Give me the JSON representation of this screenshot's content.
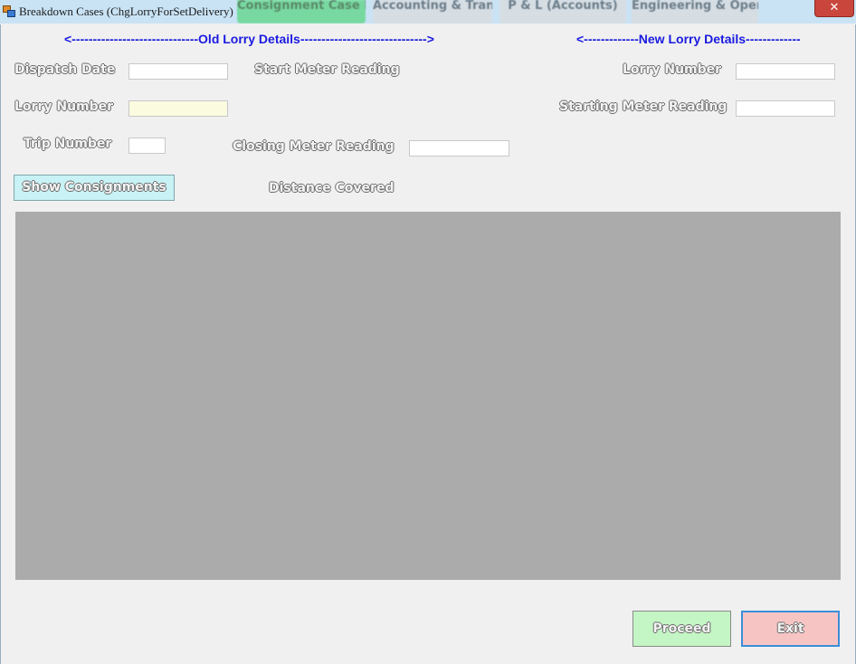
{
  "window": {
    "title": "Breakdown Cases (ChgLorryForSetDelivery)",
    "close_glyph": "✕",
    "background_tabs": [
      {
        "label": "Consignment Case Dep."
      },
      {
        "label": "Accounting & Transport"
      },
      {
        "label": "P & L (Accounts)"
      },
      {
        "label": "Engineering & Operation"
      }
    ]
  },
  "headers": {
    "old_lorry": "<------------------------------Old Lorry Details------------------------------>",
    "new_lorry": "<-------------New Lorry Details-------------"
  },
  "old_lorry": {
    "dispatch_date_label": "Dispatch Date",
    "dispatch_date_value": "",
    "lorry_number_label": "Lorry Number",
    "lorry_number_value": "",
    "trip_number_label": "Trip Number",
    "trip_number_value": "",
    "start_meter_label": "Start Meter Reading",
    "closing_meter_label": "Closing Meter Reading",
    "closing_meter_value": "",
    "distance_label": "Distance Covered",
    "show_consignments_label": "Show Consignments"
  },
  "new_lorry": {
    "lorry_number_label": "Lorry Number",
    "lorry_number_value": "",
    "starting_meter_label": "Starting Meter Reading",
    "starting_meter_value": ""
  },
  "actions": {
    "proceed_label": "Proceed",
    "exit_label": "Exit"
  },
  "colors": {
    "header_blue": "#1a1ae0",
    "proceed_bg": "#c4f5c4",
    "exit_bg": "#f7c4c4",
    "show_btn_bg": "#c8f2f5",
    "grid_bg": "#ababab"
  }
}
